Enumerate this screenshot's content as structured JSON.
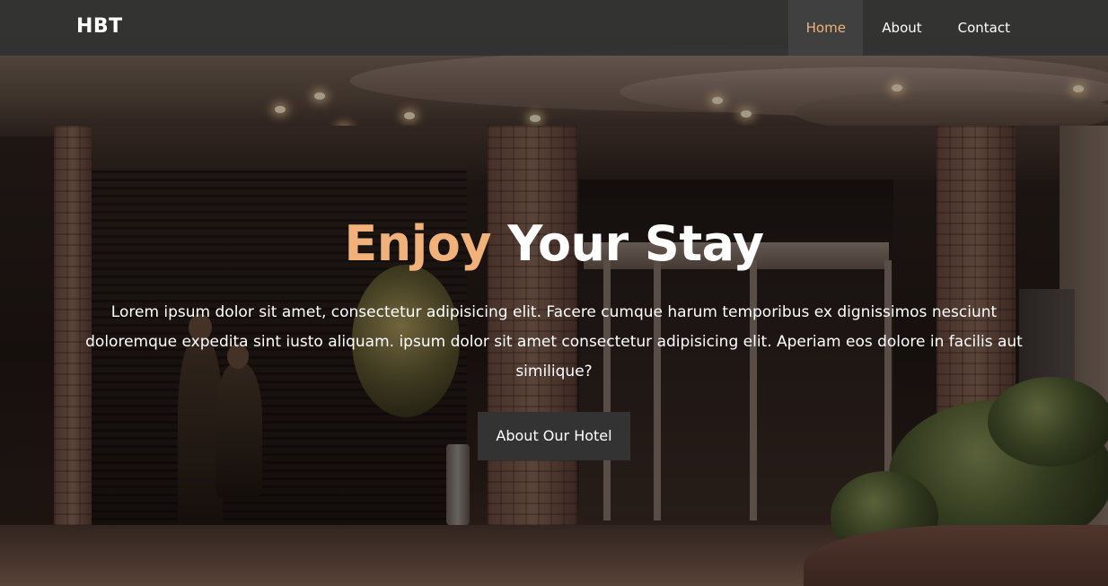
{
  "nav": {
    "brand": "HBT",
    "links": [
      {
        "label": "Home",
        "active": true
      },
      {
        "label": "About",
        "active": false
      },
      {
        "label": "Contact",
        "active": false
      }
    ]
  },
  "hero": {
    "title_accent": "Enjoy",
    "title_rest": " Your Stay",
    "text": "Lorem ipsum dolor sit amet, consectetur adipisicing elit. Facere cumque harum temporibus ex dignissimos nesciunt doloremque expedita sint iusto aliquam. ipsum dolor sit amet consectetur adipisicing elit. Aperiam eos dolore in facilis aut similique?",
    "button_label": "About Our Hotel"
  },
  "colors": {
    "accent": "#f0b27a",
    "navbar_bg": "#343434",
    "button_bg": "#333333",
    "text": "#ffffff"
  }
}
